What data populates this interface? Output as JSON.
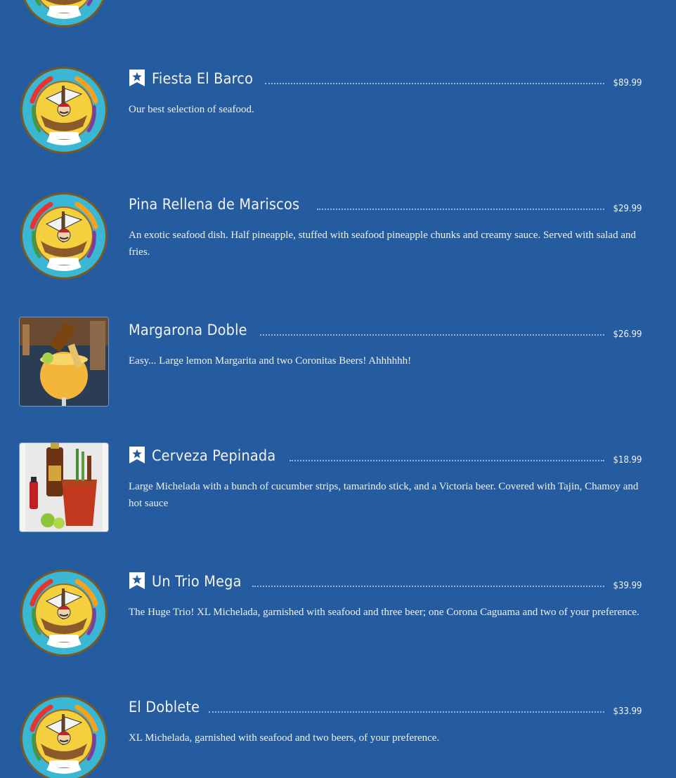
{
  "colors": {
    "background": "#245c9f",
    "text": "#f2f2f2",
    "logo_ring": "#3bb7d6",
    "logo_face": "#f4cf3e"
  },
  "logo": {
    "text_top": "Fiesta Caribe",
    "text_bottom": "MILWAUKEE"
  },
  "items": [
    {
      "name": "Fiesta El Barco",
      "price": "$89.99",
      "description": "Our best selection of seafood.",
      "featured": true,
      "image": "logo"
    },
    {
      "name": "Pina Rellena de Mariscos",
      "price": "$29.99",
      "description": "An exotic seafood dish. Half pineapple, stuffed with seafood pineapple chunks and creamy sauce. Served with salad and fries.",
      "featured": false,
      "image": "logo"
    },
    {
      "name": "Margarona Doble",
      "price": "$26.99",
      "description": "Easy... Large lemon Margarita and two Coronitas Beers! Ahhhhhh!",
      "featured": false,
      "image": "margarita-photo"
    },
    {
      "name": "Cerveza Pepinada",
      "price": "$18.99",
      "description": "Large Michelada with a bunch of cucumber strips, tamarindo stick, and a Victoria beer. Covered with Tajin, Chamoy and hot sauce",
      "featured": true,
      "image": "michelada-photo"
    },
    {
      "name": "Un Trio Mega",
      "price": "$39.99",
      "description": "The Huge Trio! XL Michelada, garnished with seafood and three beer; one Corona Caguama and two of your preference.",
      "featured": true,
      "image": "logo"
    },
    {
      "name": "El Doblete",
      "price": "$33.99",
      "description": "XL Michelada, garnished with seafood and two beers, of your preference.",
      "featured": false,
      "image": "logo"
    }
  ]
}
